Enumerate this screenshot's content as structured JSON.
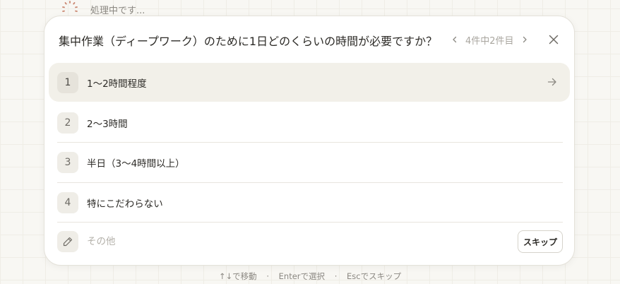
{
  "status": {
    "text": "処理中です..."
  },
  "dialog": {
    "question": "集中作業（ディープワーク）のために1日どのくらいの時間が必要ですか？",
    "pager": {
      "text": "4件中2件目",
      "prev_icon": "chevron-left-icon",
      "next_icon": "chevron-right-icon"
    },
    "close_icon": "close-icon",
    "options": [
      {
        "number": "1",
        "label": "1〜2時間程度",
        "selected": true
      },
      {
        "number": "2",
        "label": "2〜3時間",
        "selected": false
      },
      {
        "number": "3",
        "label": "半日（3〜4時間以上）",
        "selected": false
      },
      {
        "number": "4",
        "label": "特にこだわらない",
        "selected": false
      }
    ],
    "other": {
      "placeholder": "その他",
      "icon": "pencil-icon"
    },
    "skip_label": "スキップ"
  },
  "hints": {
    "move": "↑↓で移動",
    "enter": "Enterで選択",
    "esc": "Escでスキップ"
  },
  "colors": {
    "background": "#f8f7f3",
    "card": "#ffffff",
    "selected_option": "#f2f0e9",
    "spinner": "#c9856f"
  }
}
